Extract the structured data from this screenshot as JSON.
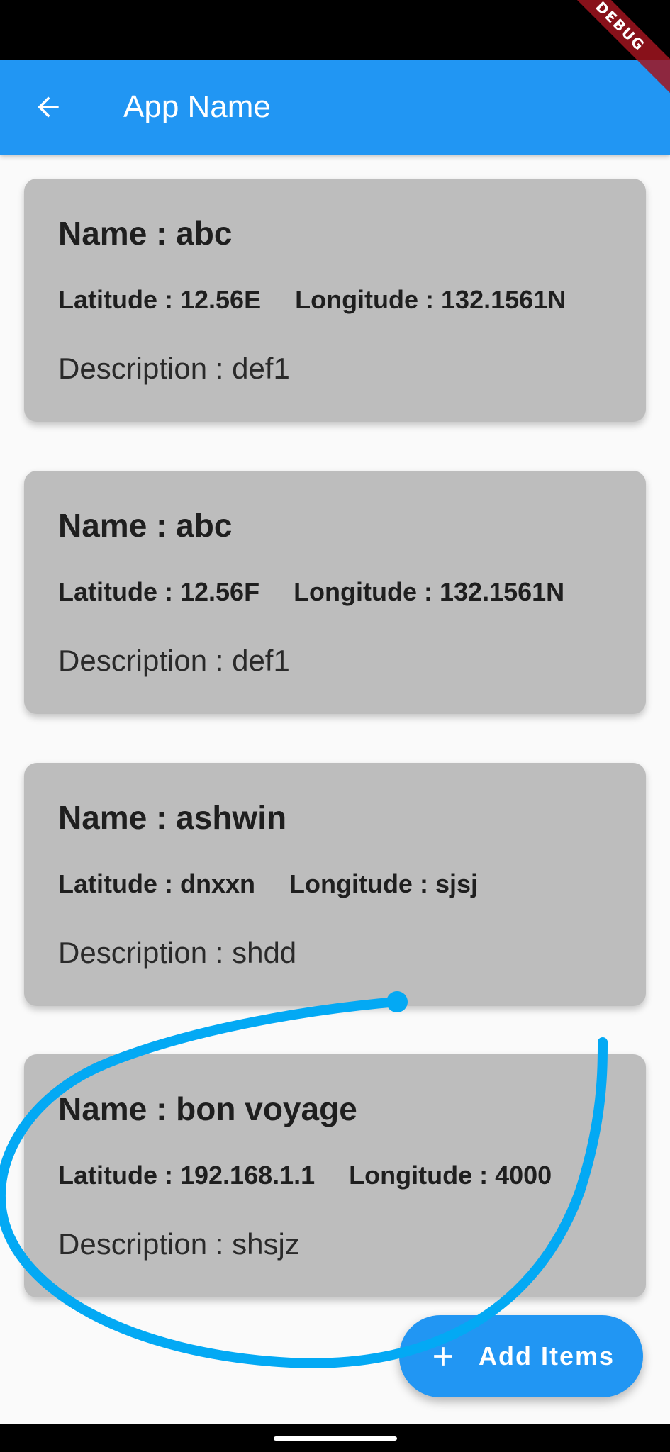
{
  "debug_banner": "DEBUG",
  "app_bar": {
    "title": "App Name",
    "back_icon": "arrow-back-icon"
  },
  "cards": [
    {
      "name": "Name : abc",
      "latitude": "Latitude : 12.56E",
      "longitude": "Longitude : 132.1561N",
      "description": "Description : def1"
    },
    {
      "name": "Name : abc",
      "latitude": "Latitude : 12.56F",
      "longitude": "Longitude : 132.1561N",
      "description": "Description : def1"
    },
    {
      "name": "Name : ashwin",
      "latitude": "Latitude : dnxxn",
      "longitude": "Longitude : sjsj",
      "description": "Description : shdd"
    },
    {
      "name": "Name : bon voyage",
      "latitude": "Latitude : 192.168.1.1",
      "longitude": "Longitude : 4000",
      "description": "Description : shsjz"
    }
  ],
  "fab": {
    "label": "Add Items",
    "icon": "plus-icon"
  },
  "colors": {
    "primary": "#2196f3",
    "card_background": "#bdbdbd",
    "annotation_stroke": "#03a9f4"
  }
}
